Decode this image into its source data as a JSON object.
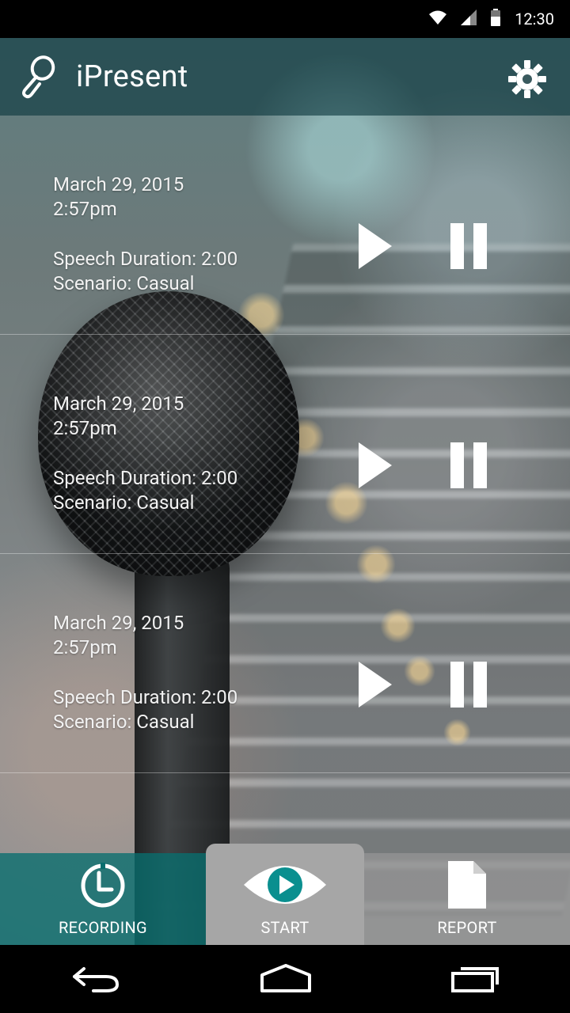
{
  "status_bar": {
    "time": "12:30"
  },
  "app_bar": {
    "title": "iPresent"
  },
  "recordings": [
    {
      "date": "March 29, 2015",
      "time": "2:57pm",
      "duration": "Speech Duration: 2:00",
      "scenario": "Scenario: Casual"
    },
    {
      "date": "March 29, 2015",
      "time": "2:57pm",
      "duration": "Speech Duration: 2:00",
      "scenario": "Scenario: Casual"
    },
    {
      "date": "March 29, 2015",
      "time": "2:57pm",
      "duration": "Speech Duration: 2:00",
      "scenario": "Scenario: Casual"
    }
  ],
  "tabs": [
    {
      "label": "RECORDING",
      "icon": "clock-icon"
    },
    {
      "label": "START",
      "icon": "eye-play-icon"
    },
    {
      "label": "REPORT",
      "icon": "document-icon"
    }
  ],
  "colors": {
    "accent": "#0a8f8f",
    "tab_recording_bg": "#086e6e",
    "tab_start_bg": "#a6a6a6"
  }
}
